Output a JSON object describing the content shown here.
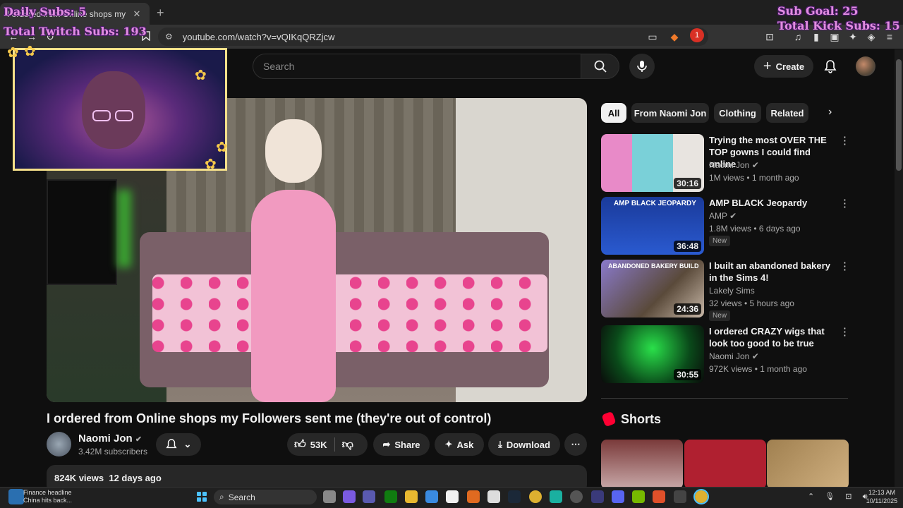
{
  "browser": {
    "tab_title": "I ordered from Online shops my",
    "url": "youtube.com/watch?v=vQIKqQRZjcw",
    "ext_badge": "1"
  },
  "overlay": {
    "daily_subs": "Daily Subs: 5",
    "total_twitch": "Total Twitch Subs: 193",
    "sub_goal": "Sub Goal: 25",
    "total_kick": "Total Kick Subs: 15"
  },
  "header": {
    "search_placeholder": "Search",
    "create_label": "Create"
  },
  "video": {
    "title": "I ordered from Online shops my Followers sent me (they're out of control)",
    "channel": "Naomi Jon",
    "subscribers": "3.42M subscribers",
    "likes": "53K",
    "share_label": "Share",
    "ask_label": "Ask",
    "download_label": "Download",
    "views": "824K views",
    "date": "12 days ago"
  },
  "chips": [
    "All",
    "From Naomi Jon",
    "Clothing",
    "Related"
  ],
  "recommendations": [
    {
      "title": "Trying the most OVER THE TOP gowns I could find online",
      "channel": "Naomi Jon",
      "meta": "1M views • 1 month ago",
      "duration": "30:16",
      "new": ""
    },
    {
      "title": "AMP BLACK Jeopardy",
      "channel": "AMP",
      "meta": "1.8M views • 6 days ago",
      "duration": "36:48",
      "new": "New",
      "thumb_text": "AMP BLACK JEOPARDY"
    },
    {
      "title": "I built an abandoned bakery in the Sims 4!",
      "channel": "Lakely Sims",
      "meta": "32 views • 5 hours ago",
      "duration": "24:36",
      "new": "New",
      "thumb_text": "ABANDONED BAKERY BUILD"
    },
    {
      "title": "I ordered CRAZY wigs that look too good to be true",
      "channel": "Naomi Jon",
      "meta": "972K views • 1 month ago",
      "duration": "30:55",
      "new": ""
    }
  ],
  "shorts_label": "Shorts",
  "taskbar": {
    "news_title": "Finance headline",
    "news_sub": "China hits back...",
    "search_label": "Search",
    "time": "12:13 AM",
    "date": "10/11/2025"
  },
  "colors": {
    "accent": "#ff0033",
    "overlay_text": "#e28de0",
    "cam_border": "#f5e08a"
  }
}
